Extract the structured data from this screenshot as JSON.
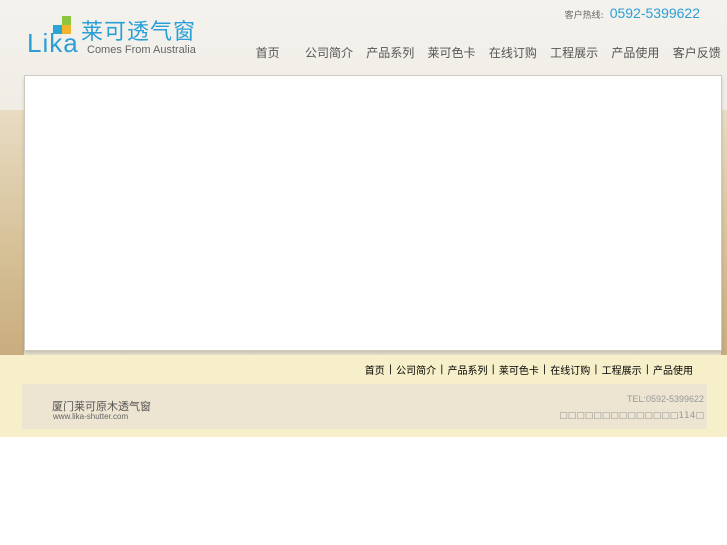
{
  "brand": {
    "wordmark": "Lika",
    "name_cn": "莱可透气窗",
    "tagline": "Comes From Australia",
    "colors": {
      "blue": "#2a9fd6",
      "green": "#8cc63f",
      "yellow": "#f0b429"
    }
  },
  "hotline": {
    "label": "客户热线:",
    "number": "0592-5399622"
  },
  "nav": {
    "items": [
      {
        "label": "首页"
      },
      {
        "label": "公司简介"
      },
      {
        "label": "产品系列"
      },
      {
        "label": "莱可色卡"
      },
      {
        "label": "在线订购"
      },
      {
        "label": "工程展示"
      },
      {
        "label": "产品使用"
      },
      {
        "label": "客户反馈"
      }
    ]
  },
  "footer": {
    "links": [
      {
        "label": "首页"
      },
      {
        "label": "公司简介"
      },
      {
        "label": "产品系列"
      },
      {
        "label": "莱可色卡"
      },
      {
        "label": "在线订购"
      },
      {
        "label": "工程展示"
      },
      {
        "label": "产品使用"
      }
    ],
    "separator": "|",
    "company": "厦门莱可原木透气窗",
    "url": "www.lika-shutter.com",
    "tel": "TEL:0592-5399622",
    "address": "□□□□□□□□□□□□□□114□"
  }
}
